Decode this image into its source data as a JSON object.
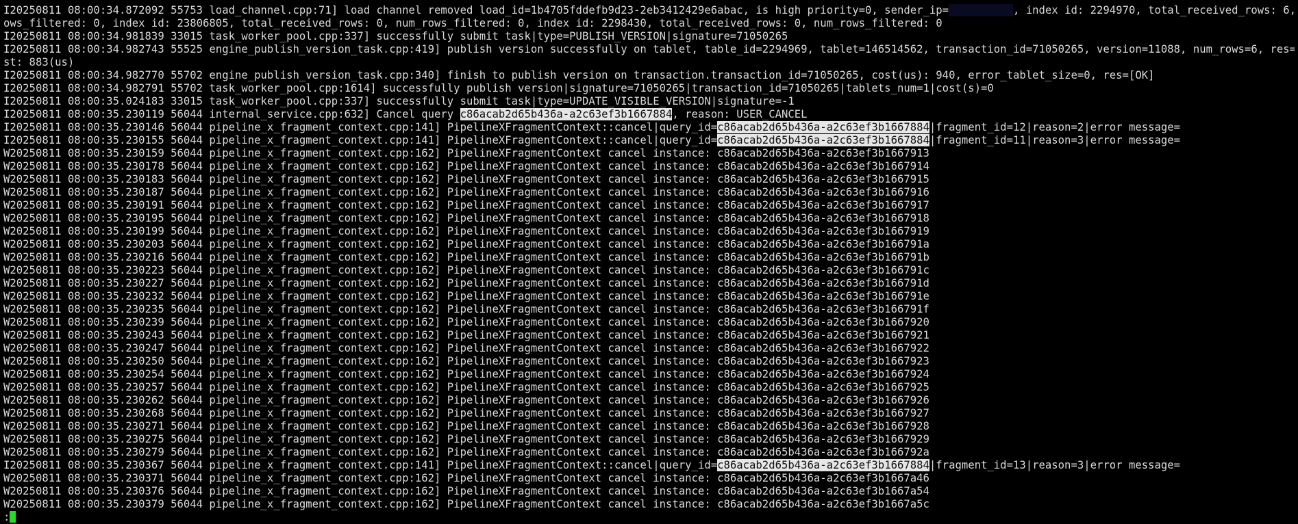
{
  "terminal": {
    "lines": [
      [
        {
          "t": "I20250811 08:00:34.872092 55753 load_channel.cpp:71] load channel removed load_id=1b4705fddefb9d23-2eb3412429e6abac, is high priority=0, sender_ip="
        },
        {
          "t": "          ",
          "mask": true
        },
        {
          "t": ", index id: 2294970, total_received_rows: 6, num_r"
        }
      ],
      [
        {
          "t": "ows_filtered: 0, index id: 23806805, total_received_rows: 0, num_rows_filtered: 0, index id: 2298430, total_received_rows: 0, num_rows_filtered: 0"
        }
      ],
      [
        {
          "t": "I20250811 08:00:34.981839 33015 task_worker_pool.cpp:337] successfully submit task|type=PUBLISH_VERSION|signature=71050265"
        }
      ],
      [
        {
          "t": "I20250811 08:00:34.982743 55525 engine_publish_version_task.cpp:419] publish version successfully on tablet, table_id=2294969, tablet=146514562, transaction_id=71050265, version=11088, num_rows=6, res=[OK], co"
        }
      ],
      [
        {
          "t": "st: 883(us)"
        }
      ],
      [
        {
          "t": "I20250811 08:00:34.982770 55702 engine_publish_version_task.cpp:340] finish to publish version on transaction.transaction_id=71050265, cost(us): 940, error_tablet_size=0, res=[OK]"
        }
      ],
      [
        {
          "t": "I20250811 08:00:34.982791 55702 task_worker_pool.cpp:1614] successfully publish version|signature=71050265|transaction_id=71050265|tablets_num=1|cost(s)=0"
        }
      ],
      [
        {
          "t": "I20250811 08:00:35.024183 33015 task_worker_pool.cpp:337] successfully submit task|type=UPDATE_VISIBLE_VERSION|signature=-1"
        }
      ],
      [
        {
          "t": "I20250811 08:00:35.230119 56044 internal_service.cpp:632] Cancel query "
        },
        {
          "t": "c86acab2d65b436a-a2c63ef3b1667884",
          "hl": true
        },
        {
          "t": ", reason: USER_CANCEL"
        }
      ],
      [
        {
          "t": "I20250811 08:00:35.230146 56044 pipeline_x_fragment_context.cpp:141] PipelineXFragmentContext::cancel|query_id="
        },
        {
          "t": "c86acab2d65b436a-a2c63ef3b1667884",
          "hl": true
        },
        {
          "t": "|fragment_id=12|reason=2|error message="
        }
      ],
      [
        {
          "t": "I20250811 08:00:35.230155 56044 pipeline_x_fragment_context.cpp:141] PipelineXFragmentContext::cancel|query_id="
        },
        {
          "t": "c86acab2d65b436a-a2c63ef3b1667884",
          "hl": true
        },
        {
          "t": "|fragment_id=11|reason=3|error message="
        }
      ],
      [
        {
          "t": "W20250811 08:00:35.230159 56044 pipeline_x_fragment_context.cpp:162] PipelineXFragmentContext cancel instance: c86acab2d65b436a-a2c63ef3b1667913"
        }
      ],
      [
        {
          "t": "W20250811 08:00:35.230178 56044 pipeline_x_fragment_context.cpp:162] PipelineXFragmentContext cancel instance: c86acab2d65b436a-a2c63ef3b1667914"
        }
      ],
      [
        {
          "t": "W20250811 08:00:35.230183 56044 pipeline_x_fragment_context.cpp:162] PipelineXFragmentContext cancel instance: c86acab2d65b436a-a2c63ef3b1667915"
        }
      ],
      [
        {
          "t": "W20250811 08:00:35.230187 56044 pipeline_x_fragment_context.cpp:162] PipelineXFragmentContext cancel instance: c86acab2d65b436a-a2c63ef3b1667916"
        }
      ],
      [
        {
          "t": "W20250811 08:00:35.230191 56044 pipeline_x_fragment_context.cpp:162] PipelineXFragmentContext cancel instance: c86acab2d65b436a-a2c63ef3b1667917"
        }
      ],
      [
        {
          "t": "W20250811 08:00:35.230195 56044 pipeline_x_fragment_context.cpp:162] PipelineXFragmentContext cancel instance: c86acab2d65b436a-a2c63ef3b1667918"
        }
      ],
      [
        {
          "t": "W20250811 08:00:35.230199 56044 pipeline_x_fragment_context.cpp:162] PipelineXFragmentContext cancel instance: c86acab2d65b436a-a2c63ef3b1667919"
        }
      ],
      [
        {
          "t": "W20250811 08:00:35.230203 56044 pipeline_x_fragment_context.cpp:162] PipelineXFragmentContext cancel instance: c86acab2d65b436a-a2c63ef3b166791a"
        }
      ],
      [
        {
          "t": "W20250811 08:00:35.230216 56044 pipeline_x_fragment_context.cpp:162] PipelineXFragmentContext cancel instance: c86acab2d65b436a-a2c63ef3b166791b"
        }
      ],
      [
        {
          "t": "W20250811 08:00:35.230223 56044 pipeline_x_fragment_context.cpp:162] PipelineXFragmentContext cancel instance: c86acab2d65b436a-a2c63ef3b166791c"
        }
      ],
      [
        {
          "t": "W20250811 08:00:35.230227 56044 pipeline_x_fragment_context.cpp:162] PipelineXFragmentContext cancel instance: c86acab2d65b436a-a2c63ef3b166791d"
        }
      ],
      [
        {
          "t": "W20250811 08:00:35.230232 56044 pipeline_x_fragment_context.cpp:162] PipelineXFragmentContext cancel instance: c86acab2d65b436a-a2c63ef3b166791e"
        }
      ],
      [
        {
          "t": "W20250811 08:00:35.230235 56044 pipeline_x_fragment_context.cpp:162] PipelineXFragmentContext cancel instance: c86acab2d65b436a-a2c63ef3b166791f"
        }
      ],
      [
        {
          "t": "W20250811 08:00:35.230239 56044 pipeline_x_fragment_context.cpp:162] PipelineXFragmentContext cancel instance: c86acab2d65b436a-a2c63ef3b1667920"
        }
      ],
      [
        {
          "t": "W20250811 08:00:35.230243 56044 pipeline_x_fragment_context.cpp:162] PipelineXFragmentContext cancel instance: c86acab2d65b436a-a2c63ef3b1667921"
        }
      ],
      [
        {
          "t": "W20250811 08:00:35.230247 56044 pipeline_x_fragment_context.cpp:162] PipelineXFragmentContext cancel instance: c86acab2d65b436a-a2c63ef3b1667922"
        }
      ],
      [
        {
          "t": "W20250811 08:00:35.230250 56044 pipeline_x_fragment_context.cpp:162] PipelineXFragmentContext cancel instance: c86acab2d65b436a-a2c63ef3b1667923"
        }
      ],
      [
        {
          "t": "W20250811 08:00:35.230254 56044 pipeline_x_fragment_context.cpp:162] PipelineXFragmentContext cancel instance: c86acab2d65b436a-a2c63ef3b1667924"
        }
      ],
      [
        {
          "t": "W20250811 08:00:35.230257 56044 pipeline_x_fragment_context.cpp:162] PipelineXFragmentContext cancel instance: c86acab2d65b436a-a2c63ef3b1667925"
        }
      ],
      [
        {
          "t": "W20250811 08:00:35.230262 56044 pipeline_x_fragment_context.cpp:162] PipelineXFragmentContext cancel instance: c86acab2d65b436a-a2c63ef3b1667926"
        }
      ],
      [
        {
          "t": "W20250811 08:00:35.230268 56044 pipeline_x_fragment_context.cpp:162] PipelineXFragmentContext cancel instance: c86acab2d65b436a-a2c63ef3b1667927"
        }
      ],
      [
        {
          "t": "W20250811 08:00:35.230271 56044 pipeline_x_fragment_context.cpp:162] PipelineXFragmentContext cancel instance: c86acab2d65b436a-a2c63ef3b1667928"
        }
      ],
      [
        {
          "t": "W20250811 08:00:35.230275 56044 pipeline_x_fragment_context.cpp:162] PipelineXFragmentContext cancel instance: c86acab2d65b436a-a2c63ef3b1667929"
        }
      ],
      [
        {
          "t": "W20250811 08:00:35.230279 56044 pipeline_x_fragment_context.cpp:162] PipelineXFragmentContext cancel instance: c86acab2d65b436a-a2c63ef3b166792a"
        }
      ],
      [
        {
          "t": "I20250811 08:00:35.230367 56044 pipeline_x_fragment_context.cpp:141] PipelineXFragmentContext::cancel|query_id="
        },
        {
          "t": "c86acab2d65b436a-a2c63ef3b1667884",
          "hl": true
        },
        {
          "t": "|fragment_id=13|reason=3|error message="
        }
      ],
      [
        {
          "t": "W20250811 08:00:35.230371 56044 pipeline_x_fragment_context.cpp:162] PipelineXFragmentContext cancel instance: c86acab2d65b436a-a2c63ef3b1667a46"
        }
      ],
      [
        {
          "t": "W20250811 08:00:35.230376 56044 pipeline_x_fragment_context.cpp:162] PipelineXFragmentContext cancel instance: c86acab2d65b436a-a2c63ef3b1667a54"
        }
      ],
      [
        {
          "t": "W20250811 08:00:35.230379 56044 pipeline_x_fragment_context.cpp:162] PipelineXFragmentContext cancel instance: c86acab2d65b436a-a2c63ef3b1667a5c"
        }
      ]
    ],
    "prompt": ":",
    "colors": {
      "background": "#000000",
      "foreground": "#d8d8d8",
      "highlight_bg": "#e6e6e6",
      "cursor": "#22dd22"
    }
  }
}
